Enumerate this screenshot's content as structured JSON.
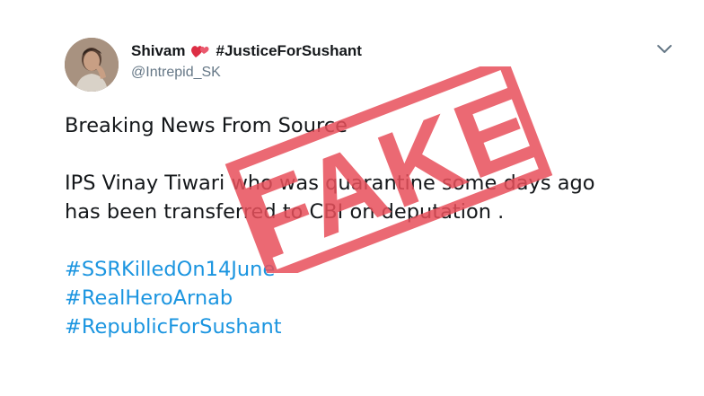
{
  "tweet": {
    "display_name": "Shivam",
    "hashtag_in_name": "#JusticeForSushant",
    "handle": "@Intrepid_SK",
    "lines": [
      "Breaking News From Source",
      "IPS Vinay Tiwari who was quarantine some days ago",
      "has been transferred to CBI on deputation ."
    ],
    "hashtags": [
      "#SSRKilledOn14June",
      "#RealHeroArnab",
      "#RepublicForSushant"
    ]
  },
  "stamp": {
    "text": "FAKE",
    "color": "#e8505b"
  },
  "colors": {
    "link": "#1b95e0",
    "text": "#14171a",
    "muted": "#657786"
  },
  "icons": {
    "avatar": "profile-photo",
    "heart": "two-hearts-emoji",
    "menu": "chevron-down-icon"
  }
}
